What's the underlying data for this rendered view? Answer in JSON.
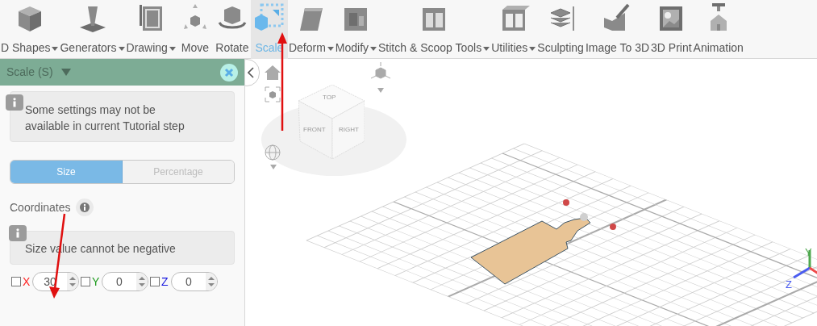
{
  "toolbar": {
    "items": [
      {
        "label": "D Shapes",
        "kind": "menu",
        "selected": false
      },
      {
        "label": "Generators",
        "kind": "menu",
        "selected": false
      },
      {
        "label": "Drawing",
        "kind": "menu",
        "selected": false
      },
      {
        "label": "Move",
        "kind": "button",
        "selected": false
      },
      {
        "label": "Rotate",
        "kind": "button",
        "selected": false
      },
      {
        "label": "Scale",
        "kind": "button",
        "selected": true
      },
      {
        "label": "Deform",
        "kind": "menu",
        "selected": false
      },
      {
        "label": "Modify",
        "kind": "menu",
        "selected": false
      },
      {
        "label": "Stitch & Scoop Tools",
        "kind": "menu",
        "selected": false
      },
      {
        "label": "Utilities",
        "kind": "menu",
        "selected": false
      },
      {
        "label": "Sculpting",
        "kind": "button",
        "selected": false
      },
      {
        "label": "Image To 3D",
        "kind": "button",
        "selected": false
      },
      {
        "label": "3D Print",
        "kind": "button",
        "selected": false
      },
      {
        "label": "Animation",
        "kind": "button",
        "selected": false
      }
    ]
  },
  "panel": {
    "title": "Scale (S)",
    "notice": "Some settings may not be available in current Tutorial step",
    "mode_tabs": [
      {
        "label": "Size",
        "selected": true
      },
      {
        "label": "Percentage",
        "selected": false
      }
    ],
    "coordinates_label": "Coordinates",
    "hint": "Size value cannot be negative",
    "axes": [
      {
        "label": "X",
        "value": "30",
        "checked": false,
        "color": "#ff2020"
      },
      {
        "label": "Y",
        "value": "0",
        "checked": false,
        "color": "#1a9a1a"
      },
      {
        "label": "Z",
        "value": "0",
        "checked": false,
        "color": "#1a1ae0"
      }
    ]
  },
  "viewport": {
    "cube_faces": [
      "TOP",
      "FRONT",
      "RIGHT"
    ],
    "axis_labels": [
      "Y",
      "Z"
    ]
  }
}
